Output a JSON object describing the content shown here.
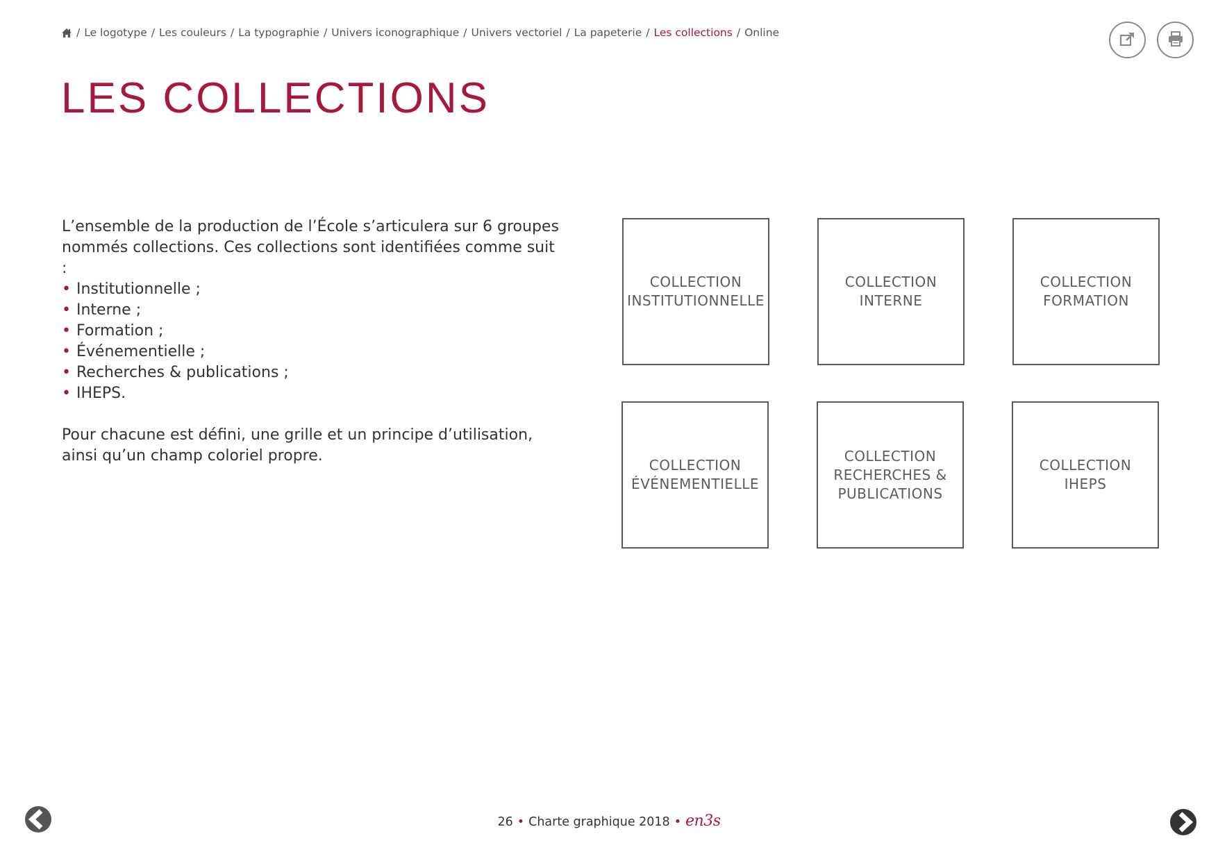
{
  "breadcrumb": {
    "items": [
      {
        "label": "Le logotype",
        "active": false
      },
      {
        "label": "Les couleurs",
        "active": false
      },
      {
        "label": "La typographie",
        "active": false
      },
      {
        "label": "Univers iconographique",
        "active": false
      },
      {
        "label": "Univers vectoriel",
        "active": false
      },
      {
        "label": "La papeterie",
        "active": false
      },
      {
        "label": "Les collections",
        "active": true
      },
      {
        "label": "Online",
        "active": false
      }
    ],
    "separator": "/"
  },
  "toolbar": {
    "external_icon": "external-link-icon",
    "print_icon": "printer-icon"
  },
  "title": "LES COLLECTIONS",
  "intro": {
    "lead": "L’ensemble de la production de l’École s’articulera sur 6 groupes nommés collections. Ces collections sont identifiées comme suit :",
    "bullet": "•",
    "items": [
      "Institutionnelle ;",
      "Interne ;",
      "Formation ;",
      "Événementielle ;",
      "Recherches & publications ;",
      "IHEPS."
    ],
    "closing": "Pour chacune est défini, une grille et un principe d’utilisation, ainsi qu’un champ coloriel propre."
  },
  "collections": [
    "COLLECTION\nINSTITUTIONNELLE",
    "COLLECTION\nINTERNE",
    "COLLECTION\nFORMATION",
    "COLLECTION\nÉVÉNEMENTIELLE",
    "COLLECTION\nRECHERCHES &\nPUBLICATIONS",
    "COLLECTION\nIHEPS"
  ],
  "footer": {
    "page_number": "26",
    "dot": "•",
    "doc_title": "Charte graphique 2018",
    "logo_text": "en3s"
  },
  "colors": {
    "accent": "#a6193c",
    "text": "#333333",
    "muted": "#555555",
    "border": "#5a5a5a"
  }
}
